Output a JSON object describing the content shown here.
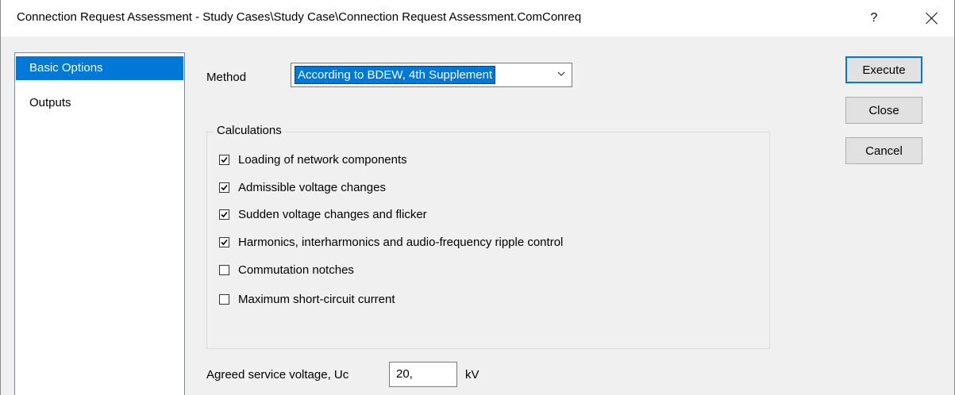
{
  "window": {
    "title": "Connection Request Assessment - Study Cases\\Study Case\\Connection Request Assessment.ComConreq",
    "help_label": "?",
    "close_icon": "close-icon"
  },
  "sidebar": {
    "items": [
      {
        "label": "Basic Options",
        "selected": true
      },
      {
        "label": "Outputs",
        "selected": false
      }
    ]
  },
  "method": {
    "label": "Method",
    "value": "According to BDEW, 4th Supplement",
    "dropdown_icon": "chevron-down-icon"
  },
  "calculations": {
    "title": "Calculations",
    "items": [
      {
        "label": "Loading of network components",
        "checked": true
      },
      {
        "label": "Admissible voltage changes",
        "checked": true
      },
      {
        "label": "Sudden voltage changes and flicker",
        "checked": true
      },
      {
        "label": "Harmonics, interharmonics and audio-frequency ripple control",
        "checked": true
      },
      {
        "label": "Commutation notches",
        "checked": false
      },
      {
        "label": "Maximum short-circuit current",
        "checked": false
      }
    ]
  },
  "buttons": {
    "execute": "Execute",
    "close": "Close",
    "cancel": "Cancel"
  },
  "service_voltage": {
    "label": "Agreed service voltage, Uc",
    "value": "20,",
    "unit": "kV"
  },
  "colors": {
    "accent": "#0078d7",
    "dialog_bg": "#f0f0f0",
    "button_bg": "#e1e1e1"
  }
}
